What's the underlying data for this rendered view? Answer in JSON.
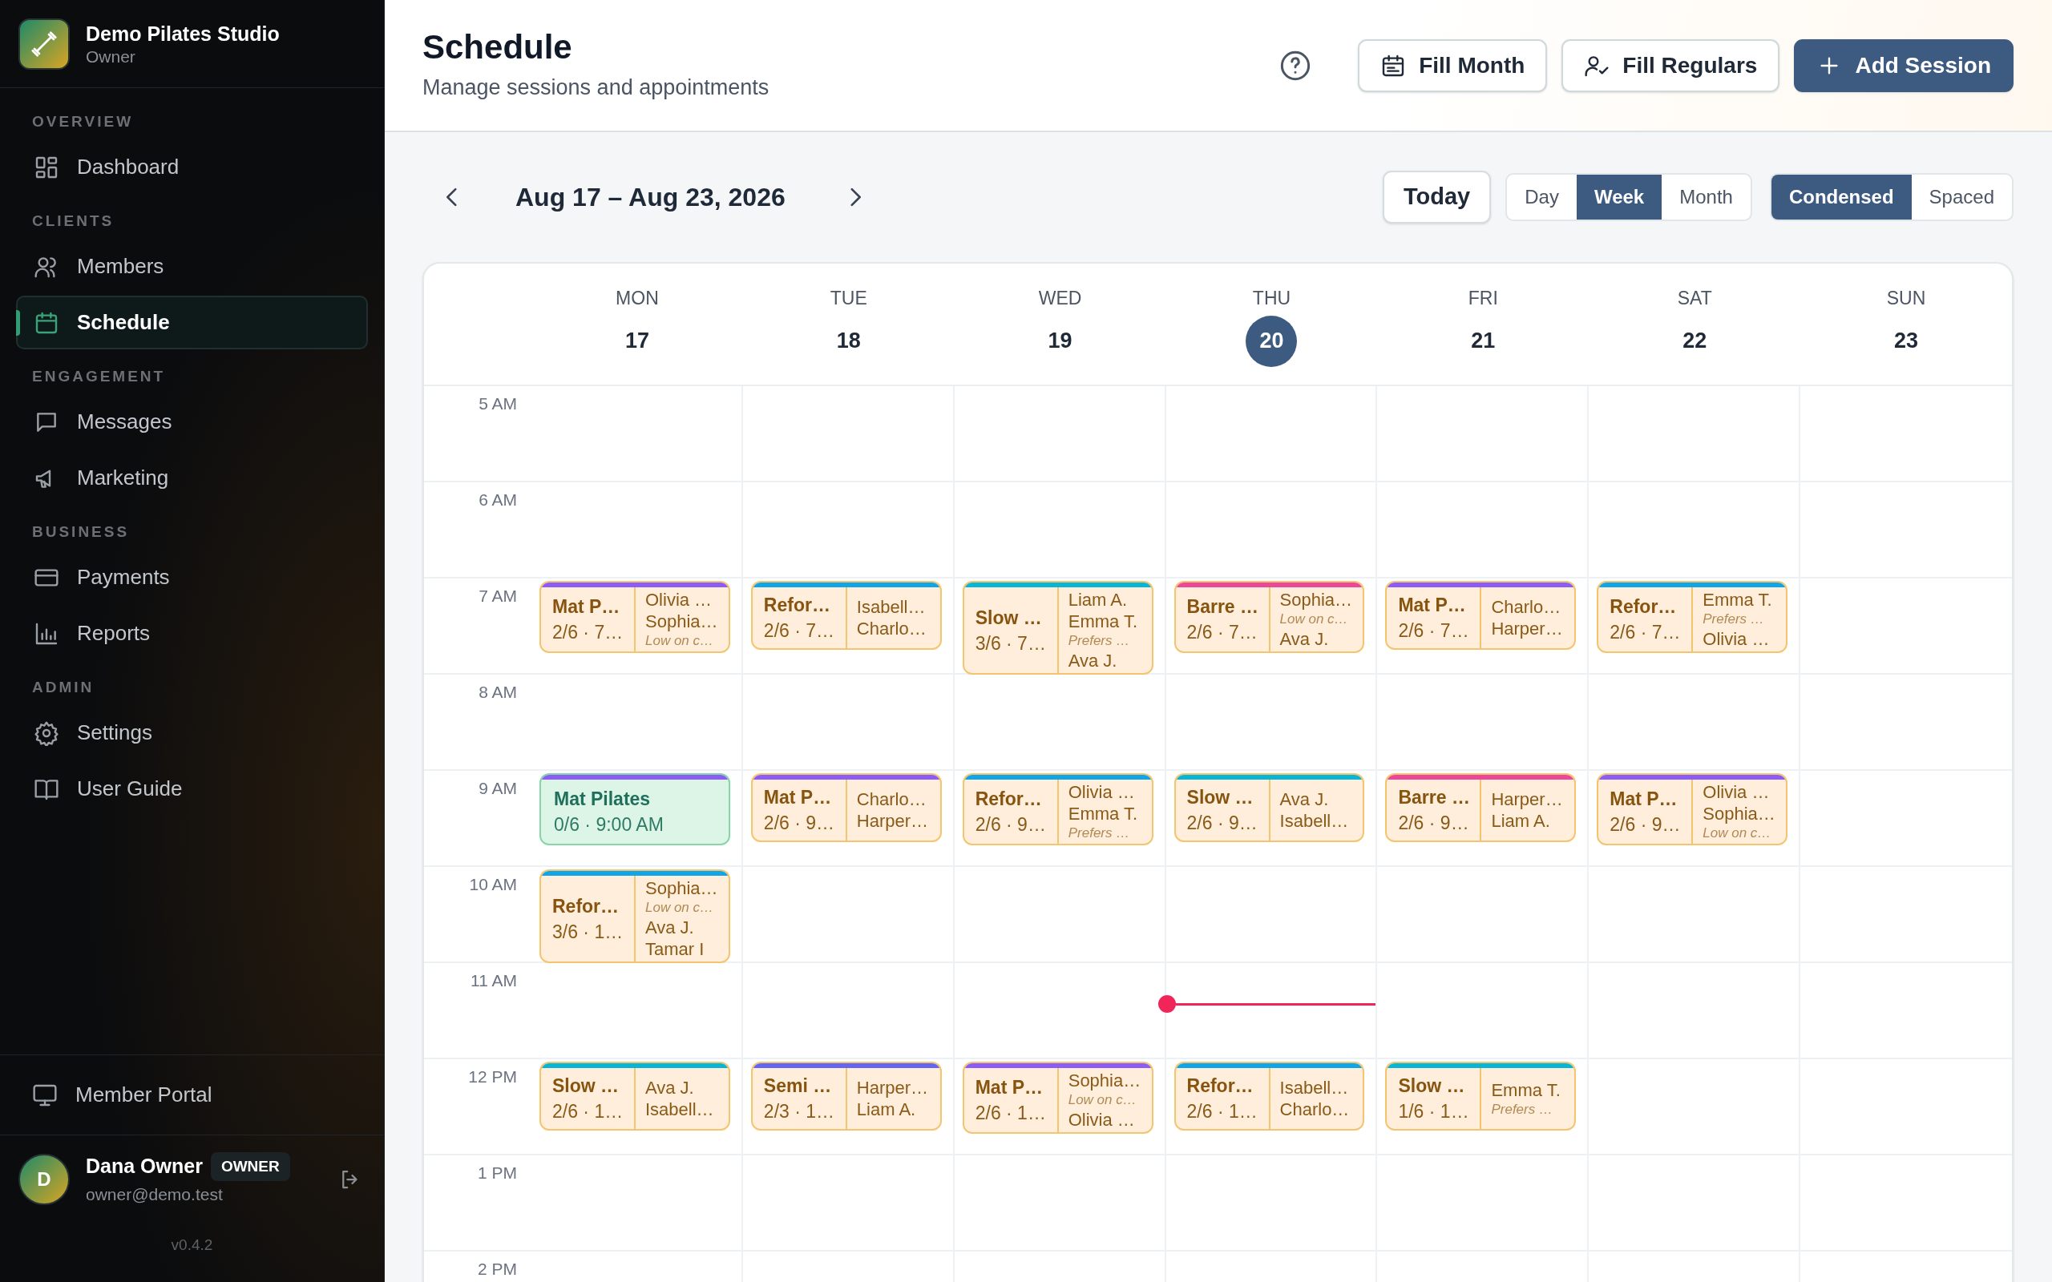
{
  "sidebar": {
    "brand": {
      "name": "Demo Pilates Studio",
      "role": "Owner"
    },
    "sections": [
      {
        "label": "OVERVIEW",
        "items": [
          {
            "label": "Dashboard",
            "selected": false
          }
        ]
      },
      {
        "label": "CLIENTS",
        "items": [
          {
            "label": "Members",
            "selected": false
          },
          {
            "label": "Schedule",
            "selected": true
          }
        ]
      },
      {
        "label": "ENGAGEMENT",
        "items": [
          {
            "label": "Messages",
            "selected": false
          },
          {
            "label": "Marketing",
            "selected": false
          }
        ]
      },
      {
        "label": "BUSINESS",
        "items": [
          {
            "label": "Payments",
            "selected": false
          },
          {
            "label": "Reports",
            "selected": false
          }
        ]
      },
      {
        "label": "ADMIN",
        "items": [
          {
            "label": "Settings",
            "selected": false
          },
          {
            "label": "User Guide",
            "selected": false
          }
        ]
      }
    ],
    "footer_link": {
      "label": "Member Portal"
    },
    "user": {
      "initial": "D",
      "name": "Dana Owner",
      "badge": "OWNER",
      "email": "owner@demo.test"
    },
    "version": "v0.4.2"
  },
  "header": {
    "title": "Schedule",
    "subtitle": "Manage sessions and appointments",
    "buttons": [
      {
        "label": "Fill Month",
        "kind": "secondary"
      },
      {
        "label": "Fill Regulars",
        "kind": "secondary"
      },
      {
        "label": "Add Session",
        "kind": "primary"
      }
    ]
  },
  "toolbar": {
    "range": "Aug 17 – Aug 23, 2026",
    "today": "Today",
    "views": [
      {
        "label": "Day",
        "selected": false
      },
      {
        "label": "Week",
        "selected": true
      },
      {
        "label": "Month",
        "selected": false
      }
    ],
    "densities": [
      {
        "label": "Condensed",
        "selected": true
      },
      {
        "label": "Spaced",
        "selected": false
      }
    ]
  },
  "calendar": {
    "days": [
      {
        "weekday": "MON",
        "date": "17",
        "today": false
      },
      {
        "weekday": "TUE",
        "date": "18",
        "today": false
      },
      {
        "weekday": "WED",
        "date": "19",
        "today": false
      },
      {
        "weekday": "THU",
        "date": "20",
        "today": true
      },
      {
        "weekday": "FRI",
        "date": "21",
        "today": false
      },
      {
        "weekday": "SAT",
        "date": "22",
        "today": false
      },
      {
        "weekday": "SUN",
        "date": "23",
        "today": false
      }
    ],
    "hours": [
      {
        "label": "5 AM",
        "cells": [
          [],
          [],
          [],
          [],
          [],
          [],
          []
        ]
      },
      {
        "label": "6 AM",
        "cells": [
          [],
          [],
          [],
          [],
          [],
          [],
          []
        ]
      },
      {
        "label": "7 AM",
        "cells": [
          [
            {
              "kind": "booked",
              "color": "#8b5cf6",
              "title": "Mat P…",
              "info": "2/6 · 7…",
              "attendees": [
                {
                  "kind": "name",
                  "text": "Olivia …"
                },
                {
                  "kind": "name",
                  "text": "Sophia…"
                },
                {
                  "kind": "note",
                  "text": "Low on c…"
                }
              ]
            }
          ],
          [
            {
              "kind": "booked",
              "color": "#0ea5e9",
              "title": "Refor…",
              "info": "2/6 · 7…",
              "attendees": [
                {
                  "kind": "name",
                  "text": "Isabell…"
                },
                {
                  "kind": "name",
                  "text": "Charlo…"
                }
              ]
            }
          ],
          [
            {
              "kind": "booked",
              "color": "#06b6d4",
              "title": "Slow …",
              "info": "3/6 · 7…",
              "attendees": [
                {
                  "kind": "name",
                  "text": "Liam A."
                },
                {
                  "kind": "name",
                  "text": "Emma T."
                },
                {
                  "kind": "note",
                  "text": "Prefers …"
                },
                {
                  "kind": "name",
                  "text": "Ava J."
                }
              ]
            }
          ],
          [
            {
              "kind": "booked",
              "color": "#ec4899",
              "title": "Barre …",
              "info": "2/6 · 7…",
              "attendees": [
                {
                  "kind": "name",
                  "text": "Sophia…"
                },
                {
                  "kind": "note",
                  "text": "Low on c…"
                },
                {
                  "kind": "name",
                  "text": "Ava J."
                }
              ]
            }
          ],
          [
            {
              "kind": "booked",
              "color": "#8b5cf6",
              "title": "Mat P…",
              "info": "2/6 · 7…",
              "attendees": [
                {
                  "kind": "name",
                  "text": "Charlo…"
                },
                {
                  "kind": "name",
                  "text": "Harper…"
                }
              ]
            }
          ],
          [
            {
              "kind": "booked",
              "color": "#0ea5e9",
              "title": "Refor…",
              "info": "2/6 · 7…",
              "attendees": [
                {
                  "kind": "name",
                  "text": "Emma T."
                },
                {
                  "kind": "note",
                  "text": "Prefers …"
                },
                {
                  "kind": "name",
                  "text": "Olivia …"
                }
              ]
            }
          ],
          []
        ]
      },
      {
        "label": "8 AM",
        "cells": [
          [],
          [],
          [],
          [],
          [],
          [],
          []
        ]
      },
      {
        "label": "9 AM",
        "cells": [
          [
            {
              "kind": "open",
              "color": "#8b5cf6",
              "title": "Mat Pilates",
              "info": "0/6 · 9:00 AM"
            }
          ],
          [
            {
              "kind": "booked",
              "color": "#8b5cf6",
              "title": "Mat P…",
              "info": "2/6 · 9…",
              "attendees": [
                {
                  "kind": "name",
                  "text": "Charlo…"
                },
                {
                  "kind": "name",
                  "text": "Harper…"
                }
              ]
            }
          ],
          [
            {
              "kind": "booked",
              "color": "#0ea5e9",
              "title": "Refor…",
              "info": "2/6 · 9…",
              "attendees": [
                {
                  "kind": "name",
                  "text": "Olivia …"
                },
                {
                  "kind": "name",
                  "text": "Emma T."
                },
                {
                  "kind": "note",
                  "text": "Prefers …"
                }
              ]
            }
          ],
          [
            {
              "kind": "booked",
              "color": "#06b6d4",
              "title": "Slow …",
              "info": "2/6 · 9…",
              "attendees": [
                {
                  "kind": "name",
                  "text": "Ava J."
                },
                {
                  "kind": "name",
                  "text": "Isabell…"
                }
              ]
            }
          ],
          [
            {
              "kind": "booked",
              "color": "#ec4899",
              "title": "Barre …",
              "info": "2/6 · 9…",
              "attendees": [
                {
                  "kind": "name",
                  "text": "Harper…"
                },
                {
                  "kind": "name",
                  "text": "Liam A."
                }
              ]
            }
          ],
          [
            {
              "kind": "booked",
              "color": "#8b5cf6",
              "title": "Mat P…",
              "info": "2/6 · 9…",
              "attendees": [
                {
                  "kind": "name",
                  "text": "Olivia …"
                },
                {
                  "kind": "name",
                  "text": "Sophia…"
                },
                {
                  "kind": "note",
                  "text": "Low on c…"
                }
              ]
            }
          ],
          []
        ]
      },
      {
        "label": "10 AM",
        "cells": [
          [
            {
              "kind": "booked",
              "color": "#0ea5e9",
              "title": "Refor…",
              "info": "3/6 · 1…",
              "attendees": [
                {
                  "kind": "name",
                  "text": "Sophia…"
                },
                {
                  "kind": "note",
                  "text": "Low on c…"
                },
                {
                  "kind": "name",
                  "text": "Ava J."
                },
                {
                  "kind": "name",
                  "text": "Tamar I"
                }
              ]
            }
          ],
          [],
          [],
          [],
          [],
          [],
          []
        ]
      },
      {
        "label": "11 AM",
        "cells": [
          [],
          [],
          [],
          [],
          [],
          [],
          []
        ]
      },
      {
        "label": "12 PM",
        "cells": [
          [
            {
              "kind": "booked",
              "color": "#06b6d4",
              "title": "Slow …",
              "info": "2/6 · 1…",
              "attendees": [
                {
                  "kind": "name",
                  "text": "Ava J."
                },
                {
                  "kind": "name",
                  "text": "Isabell…"
                }
              ]
            }
          ],
          [
            {
              "kind": "booked",
              "color": "#6366f1",
              "title": "Semi …",
              "info": "2/3 · 1…",
              "attendees": [
                {
                  "kind": "name",
                  "text": "Harper…"
                },
                {
                  "kind": "name",
                  "text": "Liam A."
                }
              ]
            }
          ],
          [
            {
              "kind": "booked",
              "color": "#8b5cf6",
              "title": "Mat P…",
              "info": "2/6 · 1…",
              "attendees": [
                {
                  "kind": "name",
                  "text": "Sophia…"
                },
                {
                  "kind": "note",
                  "text": "Low on c…"
                },
                {
                  "kind": "name",
                  "text": "Olivia …"
                }
              ]
            }
          ],
          [
            {
              "kind": "booked",
              "color": "#0ea5e9",
              "title": "Refor…",
              "info": "2/6 · 1…",
              "attendees": [
                {
                  "kind": "name",
                  "text": "Isabell…"
                },
                {
                  "kind": "name",
                  "text": "Charlo…"
                }
              ]
            }
          ],
          [
            {
              "kind": "booked",
              "color": "#06b6d4",
              "title": "Slow …",
              "info": "1/6 · 1…",
              "attendees": [
                {
                  "kind": "name",
                  "text": "Emma T."
                },
                {
                  "kind": "note",
                  "text": "Prefers …"
                }
              ]
            }
          ],
          [],
          []
        ]
      },
      {
        "label": "1 PM",
        "cells": [
          [],
          [],
          [],
          [],
          [],
          [],
          []
        ]
      },
      {
        "label": "2 PM",
        "cells": [
          [],
          [],
          [],
          [],
          [],
          [],
          []
        ]
      }
    ]
  }
}
